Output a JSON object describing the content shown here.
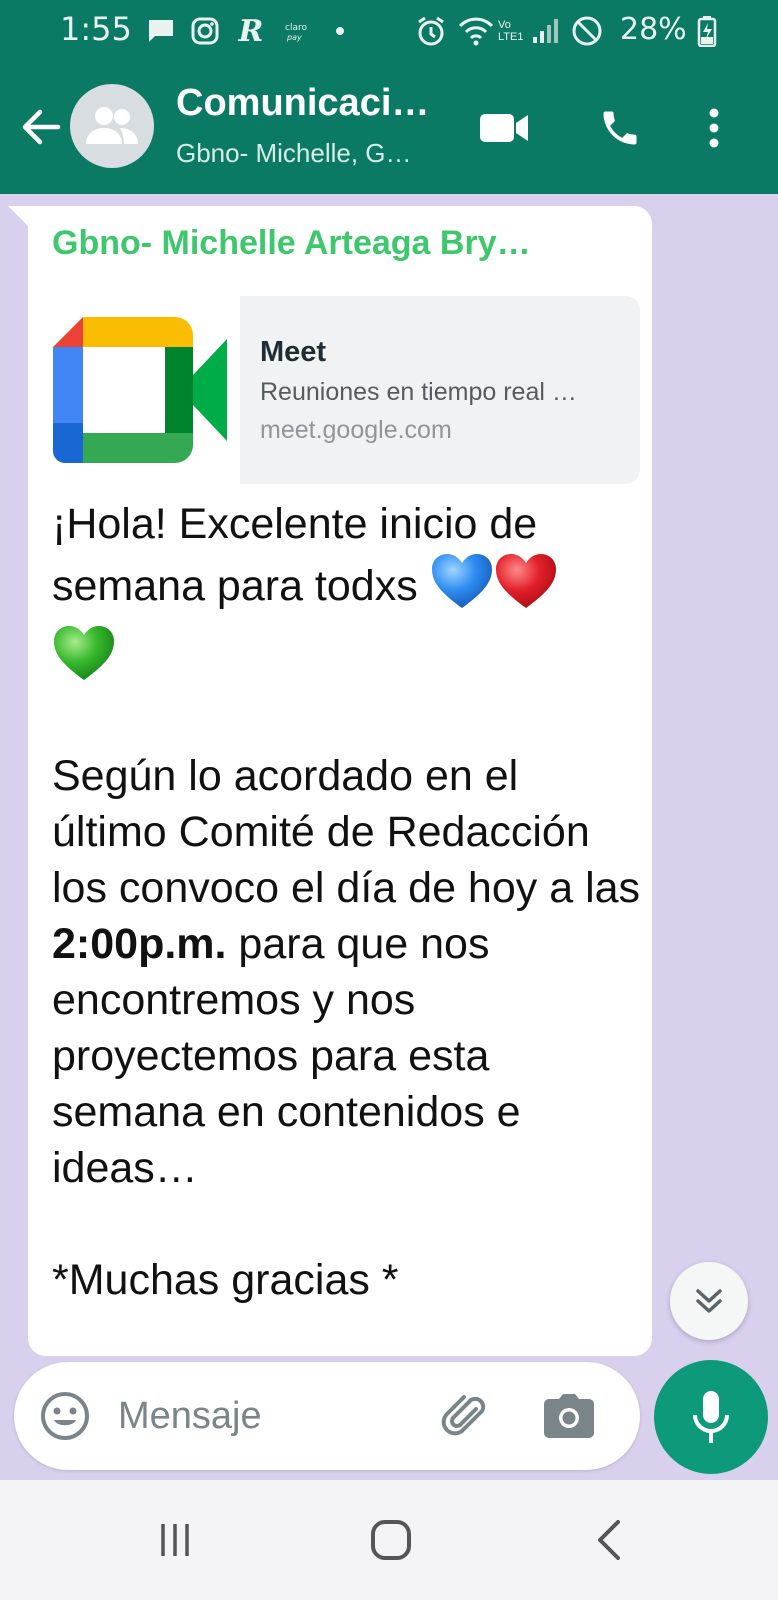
{
  "status_bar": {
    "time": "1:55",
    "battery": "28%",
    "carrier_label": "Vo LTE1"
  },
  "header": {
    "title": "Comunicaci…",
    "subtitle": "Gbno- Michelle, G…"
  },
  "message": {
    "sender": "Gbno- Michelle Arteaga Bry…",
    "link_preview": {
      "title": "Meet",
      "description": "Reuniones en tiempo real …",
      "domain": "meet.google.com"
    },
    "line1": "¡Hola! Excelente inicio de",
    "line2": "semana para todxs",
    "para2_a": "Según lo acordado en el último Comité de Redacción los convoco el día de hoy a las ",
    "para2_bold": "2:00p.m.",
    "para2_b": " para que nos encontremos y nos proyectemos para esta semana en contenidos e ideas…",
    "para3": "*Muchas gracias *"
  },
  "composer": {
    "placeholder": "Mensaje"
  },
  "colors": {
    "header_bg": "#0b7a64",
    "chat_bg": "#d9d0ee",
    "sender_name": "#3ec76d",
    "mic_button": "#0d9a7a"
  },
  "icons": {
    "back": "arrow-left-icon",
    "video": "video-camera-icon",
    "call": "phone-icon",
    "menu": "more-vert-icon",
    "emoji": "emoji-icon",
    "attach": "paperclip-icon",
    "camera": "camera-icon",
    "mic": "microphone-icon",
    "scroll_down": "chevron-double-down-icon"
  }
}
